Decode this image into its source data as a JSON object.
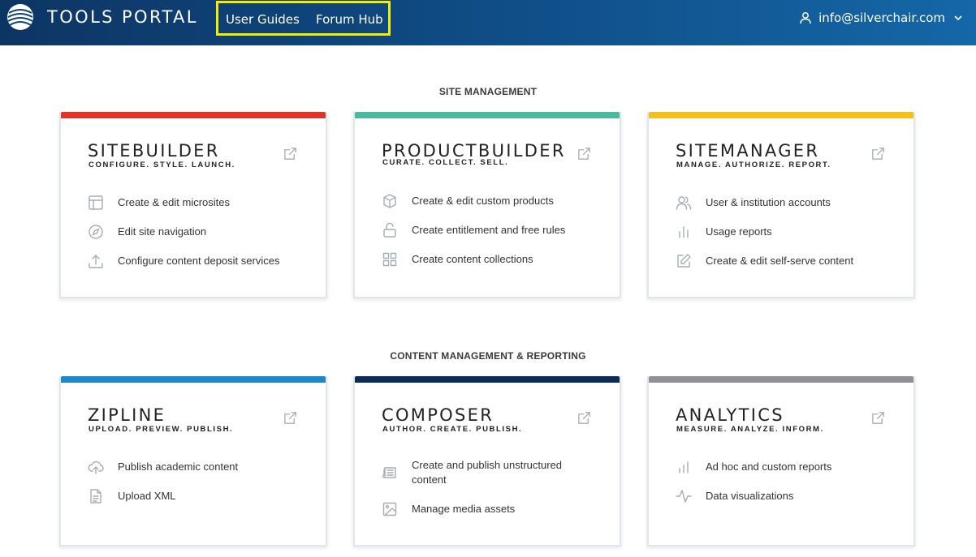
{
  "header": {
    "brand": "TOOLS PORTAL",
    "nav": [
      {
        "label": "User Guides"
      },
      {
        "label": "Forum Hub"
      }
    ],
    "user_email": "info@silverchair.com",
    "highlight_color": "#f5ec00"
  },
  "sections": [
    {
      "title": "SITE MANAGEMENT",
      "cards": [
        {
          "title": "SITEBUILDER",
          "tagline": "CONFIGURE. STYLE. LAUNCH.",
          "accent": "#e0342b",
          "items": [
            {
              "icon": "layout-icon",
              "label": "Create & edit microsites"
            },
            {
              "icon": "compass-icon",
              "label": "Edit site navigation"
            },
            {
              "icon": "upload-icon",
              "label": "Configure content deposit services"
            }
          ]
        },
        {
          "title": "PRODUCTBUILDER",
          "tagline": "CURATE. COLLECT. SELL.",
          "accent": "#4bb8a0",
          "items": [
            {
              "icon": "box-icon",
              "label": "Create & edit custom products"
            },
            {
              "icon": "unlock-icon",
              "label": "Create entitlement and free rules"
            },
            {
              "icon": "grid-icon",
              "label": "Create content collections"
            }
          ]
        },
        {
          "title": "SITEMANAGER",
          "tagline": "MANAGE. AUTHORIZE. REPORT.",
          "accent": "#f4c01e",
          "items": [
            {
              "icon": "users-icon",
              "label": "User & institution accounts"
            },
            {
              "icon": "bar-chart-icon",
              "label": "Usage reports"
            },
            {
              "icon": "edit-icon",
              "label": "Create & edit self-serve content"
            }
          ]
        }
      ]
    },
    {
      "title": "CONTENT MANAGEMENT & REPORTING",
      "cards": [
        {
          "title": "ZIPLINE",
          "tagline": "UPLOAD. PREVIEW. PUBLISH.",
          "accent": "#1b88c8",
          "items": [
            {
              "icon": "cloud-upload-icon",
              "label": "Publish academic content"
            },
            {
              "icon": "file-text-icon",
              "label": "Upload XML"
            }
          ]
        },
        {
          "title": "COMPOSER",
          "tagline": "AUTHOR. CREATE. PUBLISH.",
          "accent": "#0c2b55",
          "items": [
            {
              "icon": "newspaper-icon",
              "label": "Create and publish unstructured content"
            },
            {
              "icon": "image-icon",
              "label": "Manage media assets"
            }
          ]
        },
        {
          "title": "ANALYTICS",
          "tagline": "MEASURE. ANALYZE. INFORM.",
          "accent": "#8e9297",
          "items": [
            {
              "icon": "bar-chart-icon",
              "label": "Ad hoc and custom reports"
            },
            {
              "icon": "activity-icon",
              "label": "Data visualizations"
            }
          ]
        }
      ]
    }
  ]
}
